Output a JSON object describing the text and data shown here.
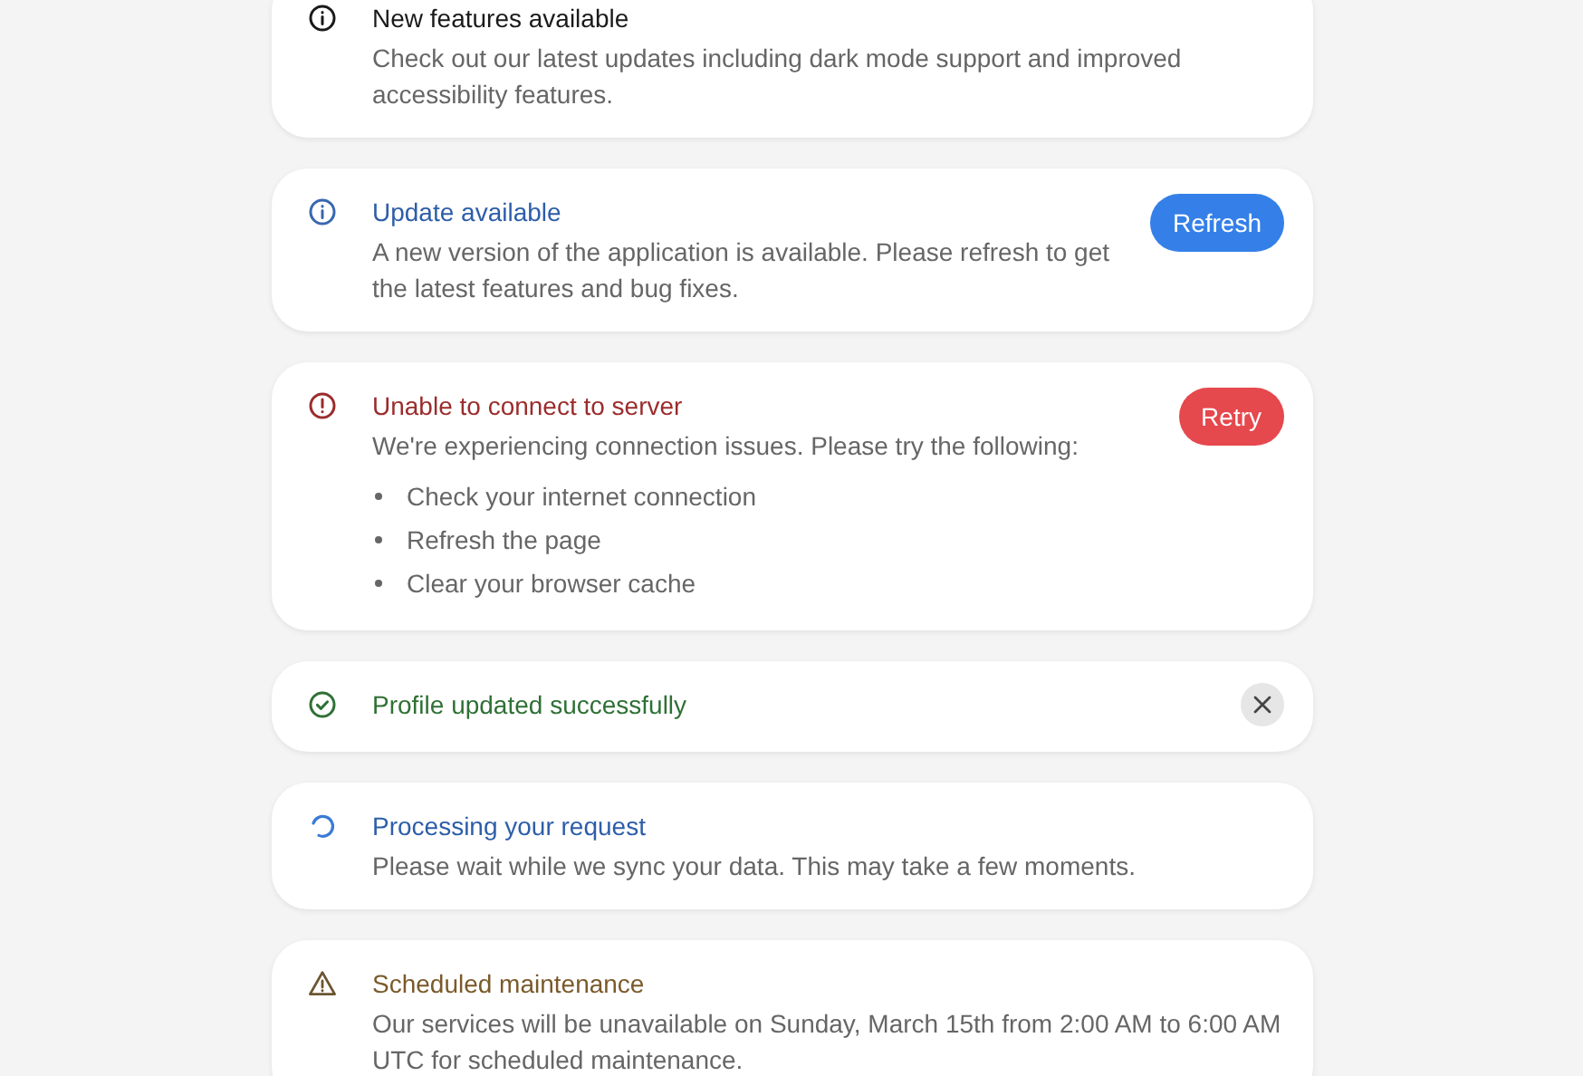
{
  "notices": [
    {
      "kind": "neutral",
      "title": "New features available",
      "message": "Check out our latest updates including dark mode support and improved accessibility features."
    },
    {
      "kind": "info",
      "title": "Update available",
      "message": "A new version of the application is available. Please refresh to get the latest features and bug fixes.",
      "action": "Refresh"
    },
    {
      "kind": "error",
      "title": "Unable to connect to server",
      "message": "We're experiencing connection issues. Please try the following:",
      "bullets": [
        "Check your internet connection",
        "Refresh the page",
        "Clear your browser cache"
      ],
      "action": "Retry"
    },
    {
      "kind": "success",
      "title": "Profile updated successfully",
      "dismissible": true
    },
    {
      "kind": "loading",
      "title": "Processing your request",
      "message": "Please wait while we sync your data. This may take a few moments."
    },
    {
      "kind": "warning",
      "title": "Scheduled maintenance",
      "message": "Our services will be unavailable on Sunday, March 15th from 2:00 AM to 6:00 AM UTC for scheduled maintenance."
    }
  ]
}
